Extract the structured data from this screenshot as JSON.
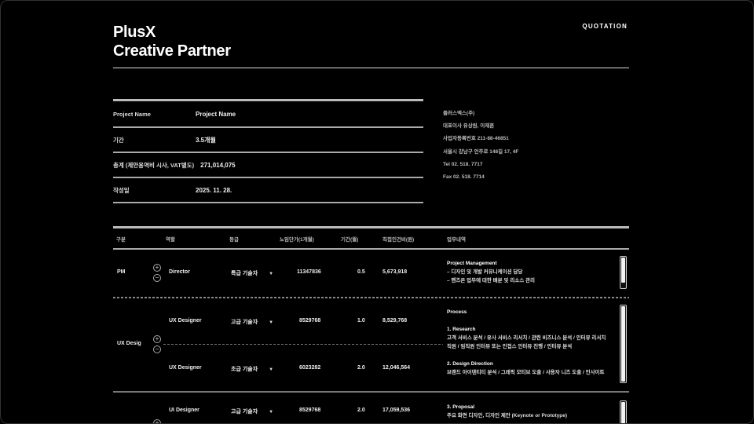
{
  "header": {
    "brand_line1": "PlusX",
    "brand_line2": "Creative Partner",
    "doc_type": "QUOTATION"
  },
  "info": {
    "rows": [
      {
        "key": "Project Name",
        "value": "Project Name"
      },
      {
        "key": "기간",
        "value": "3.5개월"
      },
      {
        "key": "총계 (제안용역비 시사, VAT별도)",
        "value": "271,014,075"
      },
      {
        "key": "작성일",
        "value": "2025. 11. 28."
      }
    ]
  },
  "company": {
    "lines": [
      "플러스엑스(주)",
      "대표이사 유상원, 이재훈",
      "사업자등록번호 211-88-46851",
      "서울시 강남구 언주로 148길 17, 4F",
      "Tel 02. 518. 7717",
      "Fax 02. 518. 7714"
    ]
  },
  "table": {
    "headers": [
      "구분",
      "역할",
      "등급",
      "노임단가(1개월)",
      "기간(월)",
      "직접인건비(원)",
      "업무내역"
    ],
    "groups": [
      {
        "category": "PM",
        "rows": [
          {
            "role": "Director",
            "grade": "특급 기술자",
            "rate": "11347836",
            "period": "0.5",
            "cost": "5,673,918"
          }
        ],
        "tasks": [
          "Project Management",
          "– 디자인 및 개발 커뮤니케이션 담당",
          "– 핸즈온 업무에 대한 배분 및 리소스 관리"
        ]
      },
      {
        "category": "UX Desig",
        "rows": [
          {
            "role": "UX Designer",
            "grade": "고급 기술자",
            "rate": "8529768",
            "period": "1.0",
            "cost": "8,529,768"
          },
          {
            "role": "UX Designer",
            "grade": "초급 기술자",
            "rate": "6023282",
            "period": "2.0",
            "cost": "12,046,564"
          }
        ],
        "tasks": [
          "Process",
          "",
          "1. Research",
          "고객 서비스 분석 / 유사 서비스 리서치 / 관련 비즈니스 분석 / 인터뷰 리서치",
          "직원 / 임직원 인터뷰 또는 인접스 인터뷰 진행 / 인터뷰 분석",
          "",
          "2. Design Direction",
          "브랜드 아이덴티티 분석 / 그래픽 모티브 도출 / 사용자 니즈 도출 / 인사이트"
        ]
      },
      {
        "category": "",
        "rows": [
          {
            "role": "UI Designer",
            "grade": "고급 기술자",
            "rate": "8529768",
            "period": "2.0",
            "cost": "17,059,536"
          }
        ],
        "tasks": [
          "3. Proposal",
          "주요 화면 디자인, 디자인 제안 (Keynote or Prototype)"
        ]
      }
    ]
  }
}
